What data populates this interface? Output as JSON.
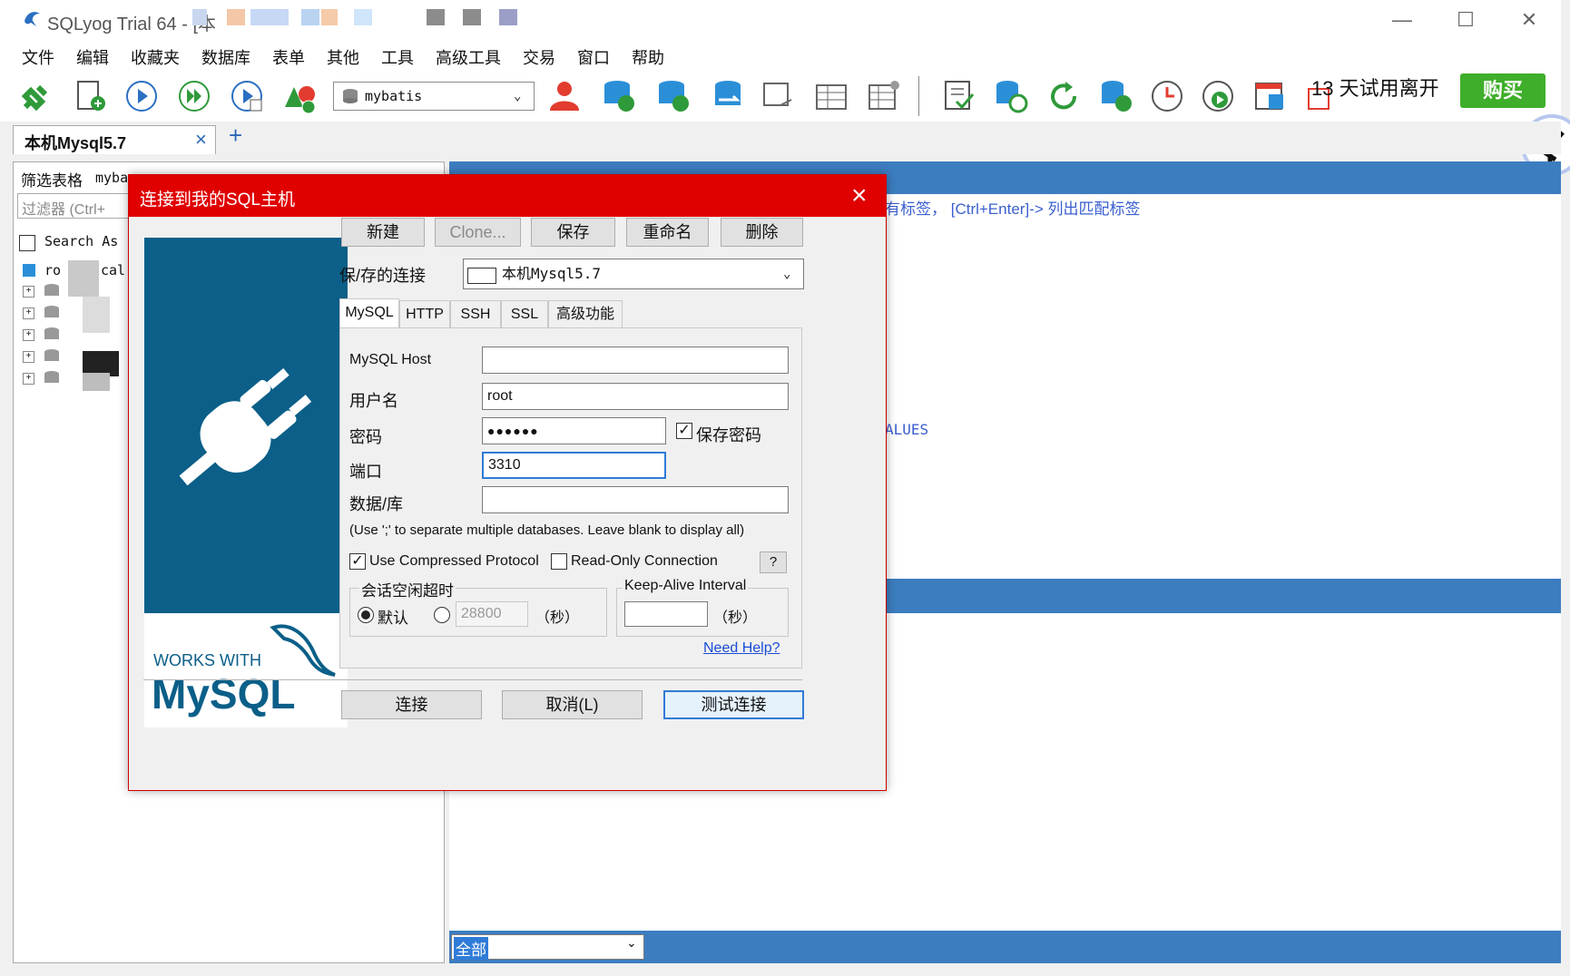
{
  "window": {
    "title": "SQLyog Trial 64 - [本",
    "minimize": "—",
    "maximize": "☐",
    "close": "✕"
  },
  "menu": [
    "文件",
    "编辑",
    "收藏夹",
    "数据库",
    "表单",
    "其他",
    "工具",
    "高级工具",
    "交易",
    "窗口",
    "帮助"
  ],
  "toolbar": {
    "database_combo": "mybatis",
    "trial_text": "13 天试用离开",
    "buy_label": "购买"
  },
  "tabs": {
    "connection_tab": "本机Mysql5.7",
    "close": "×",
    "add": "+"
  },
  "left_panel": {
    "filter_label": "筛选表格",
    "filter_value": "myba",
    "filter_placeholder": "过滤器 (Ctrl+",
    "search_label": "Search As",
    "tree_root": "ro",
    "tree_root_tail": "cal"
  },
  "editor": {
    "hint": "有标签， [Ctrl+Enter]-> 列出匹配标签",
    "values_kw": "ALUES",
    "result_filter": "全部"
  },
  "dialog": {
    "title": "连接到我的SQL主机",
    "buttons": {
      "new": "新建",
      "clone": "Clone...",
      "save": "保存",
      "rename": "重命名",
      "delete": "删除"
    },
    "saved_label": "保/存的连接",
    "saved_value": "本机Mysql5.7",
    "tabs": [
      "MySQL",
      "HTTP",
      "SSH",
      "SSL",
      "高级功能"
    ],
    "host_label": "MySQL Host",
    "host_value": "",
    "user_label": "用户名",
    "user_value": "root",
    "password_label": "密码",
    "password_value": "●●●●●●",
    "save_password_label": "保存密码",
    "port_label": "端口",
    "port_value": "3310",
    "database_label": "数据/库",
    "database_value": "",
    "database_hint": "(Use ';' to separate multiple databases. Leave blank to display all)",
    "compressed_label": "Use Compressed Protocol",
    "readonly_label": "Read-Only Connection",
    "help_q": "?",
    "session_timeout_label": "会话空闲超时",
    "default_label": "默认",
    "timeout_value": "28800",
    "seconds": "（秒）",
    "keepalive_label": "Keep-Alive Interval",
    "keepalive_value": "",
    "need_help": "Need Help?",
    "connect": "连接",
    "cancel": "取消(L)",
    "test": "测试连接",
    "logo_works": "WORKS WITH",
    "logo_mysql": "MySQL"
  },
  "colors": {
    "accent_blue": "#3c7dc0",
    "dialog_red": "#e00000",
    "buy_green": "#3fae2a",
    "plug_panel": "#0b5f88"
  }
}
